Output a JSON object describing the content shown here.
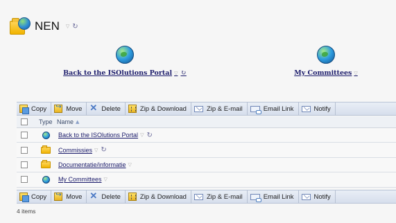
{
  "header": {
    "title": "NEN"
  },
  "tiles": [
    {
      "label": "Back to the ISOlutions Portal"
    },
    {
      "label": "My Committees"
    }
  ],
  "toolbar": {
    "copy": "Copy",
    "move": "Move",
    "delete": "Delete",
    "zip_download": "Zip & Download",
    "zip_email": "Zip & E-mail",
    "email_link": "Email Link",
    "notify": "Notify"
  },
  "list": {
    "columns": {
      "type": "Type",
      "name": "Name"
    },
    "rows": [
      {
        "icon": "globe-icon",
        "name": "Back to the ISOlutions Portal"
      },
      {
        "icon": "folder-icon",
        "name": "Commissies"
      },
      {
        "icon": "folder-icon",
        "name": "Documentatie/informatie"
      },
      {
        "icon": "globe-icon",
        "name": "My Committees"
      }
    ]
  },
  "footer": {
    "count": "4 items"
  }
}
